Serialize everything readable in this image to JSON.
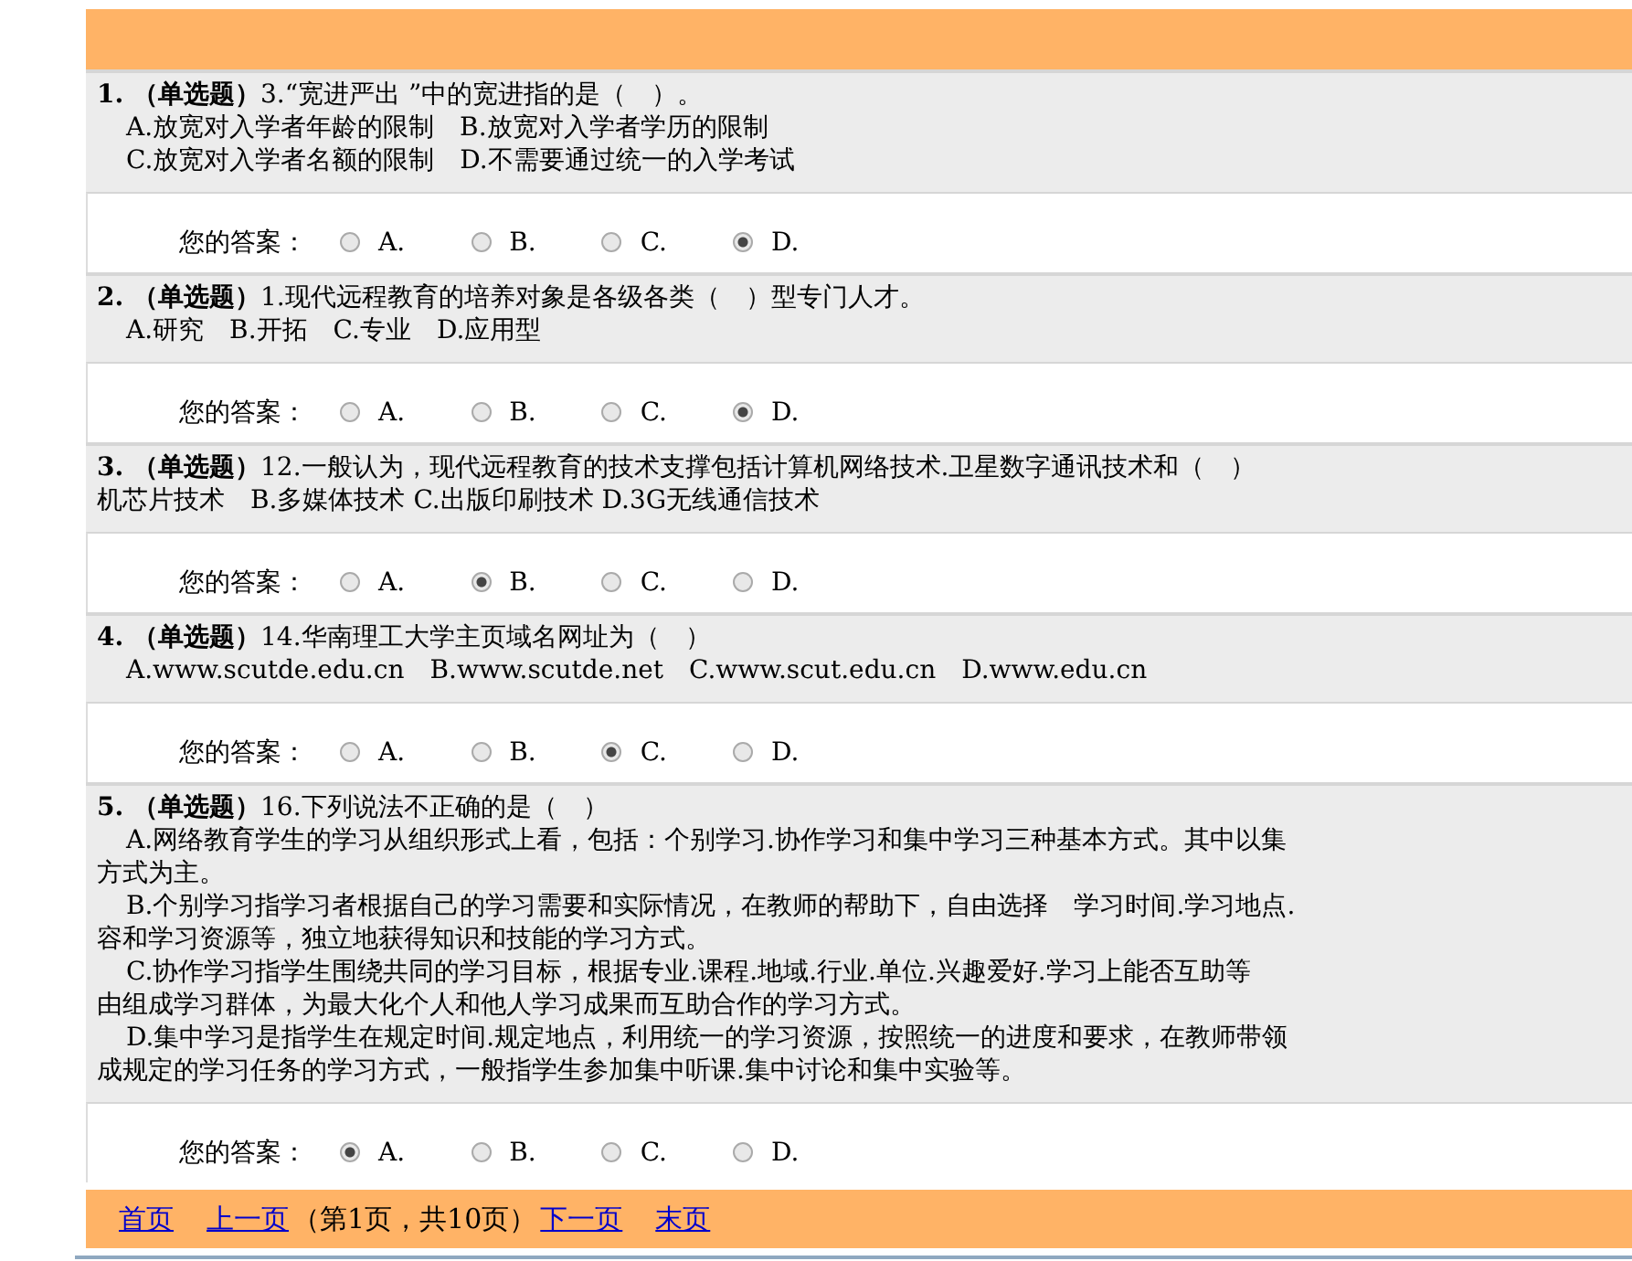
{
  "questions": [
    {
      "number": "1.",
      "type": "（单选题）",
      "text": "3.“宽进严出 ”中的宽进指的是（　）。",
      "lines": [
        {
          "kind": "option",
          "text": "A.放宽对入学者年龄的限制　B.放宽对入学者学历的限制"
        },
        {
          "kind": "option",
          "text": "C.放宽对入学者名额的限制　D.不需要通过统一的入学考试"
        }
      ],
      "answer_label": "您的答案：",
      "choices": [
        {
          "label": "A.",
          "selected": false
        },
        {
          "label": "B.",
          "selected": false
        },
        {
          "label": "C.",
          "selected": false
        },
        {
          "label": "D.",
          "selected": true
        }
      ]
    },
    {
      "number": "2.",
      "type": "（单选题）",
      "text": "1.现代远程教育的培养对象是各级各类（　）型专门人才。",
      "lines": [
        {
          "kind": "option",
          "text": "A.研究　B.开拓　C.专业　D.应用型"
        }
      ],
      "answer_label": "您的答案：",
      "choices": [
        {
          "label": "A.",
          "selected": false
        },
        {
          "label": "B.",
          "selected": false
        },
        {
          "label": "C.",
          "selected": false
        },
        {
          "label": "D.",
          "selected": true
        }
      ]
    },
    {
      "number": "3.",
      "type": "（单选题）",
      "text": "12.一般认为，现代远程教育的技术支撑包括计算机网络技术.卫星数字通讯技术和（　）",
      "lines": [
        {
          "kind": "continuation",
          "text": "机芯片技术　B.多媒体技术 C.出版印刷技术 D.3G无线通信技术"
        }
      ],
      "answer_label": "您的答案：",
      "choices": [
        {
          "label": "A.",
          "selected": false
        },
        {
          "label": "B.",
          "selected": true
        },
        {
          "label": "C.",
          "selected": false
        },
        {
          "label": "D.",
          "selected": false
        }
      ]
    },
    {
      "number": "4.",
      "type": "（单选题）",
      "text": "14.华南理工大学主页域名网址为（　）",
      "lines": [
        {
          "kind": "option",
          "text": "A.www.scutde.edu.cn　B.www.scutde.net　C.www.scut.edu.cn　D.www.edu.cn"
        }
      ],
      "answer_label": "您的答案：",
      "choices": [
        {
          "label": "A.",
          "selected": false
        },
        {
          "label": "B.",
          "selected": false
        },
        {
          "label": "C.",
          "selected": true
        },
        {
          "label": "D.",
          "selected": false
        }
      ]
    },
    {
      "number": "5.",
      "type": "（单选题）",
      "text": "16.下列说法不正确的是（　）",
      "lines": [
        {
          "kind": "option",
          "text": "A.网络教育学生的学习从组织形式上看，包括：个别学习.协作学习和集中学习三种基本方式。其中以集"
        },
        {
          "kind": "continuation",
          "text": "方式为主。"
        },
        {
          "kind": "option",
          "text": "B.个别学习指学习者根据自己的学习需要和实际情况，在教师的帮助下，自由选择　学习时间.学习地点."
        },
        {
          "kind": "continuation",
          "text": "容和学习资源等，独立地获得知识和技能的学习方式。"
        },
        {
          "kind": "option",
          "text": "C.协作学习指学生围绕共同的学习目标，根据专业.课程.地域.行业.单位.兴趣爱好.学习上能否互助等"
        },
        {
          "kind": "continuation",
          "text": "由组成学习群体，为最大化个人和他人学习成果而互助合作的学习方式。"
        },
        {
          "kind": "option",
          "text": "D.集中学习是指学生在规定时间.规定地点，利用统一的学习资源，按照统一的进度和要求，在教师带领"
        },
        {
          "kind": "continuation",
          "text": "成规定的学习任务的学习方式，一般指学生参加集中听课.集中讨论和集中实验等。"
        }
      ],
      "answer_label": "您的答案：",
      "choices": [
        {
          "label": "A.",
          "selected": true
        },
        {
          "label": "B.",
          "selected": false
        },
        {
          "label": "C.",
          "selected": false
        },
        {
          "label": "D.",
          "selected": false
        }
      ]
    }
  ],
  "pagination": {
    "first": "首页",
    "prev": "上一页",
    "info": "（第1页，共10页）",
    "next": "下一页",
    "last": "末页"
  }
}
